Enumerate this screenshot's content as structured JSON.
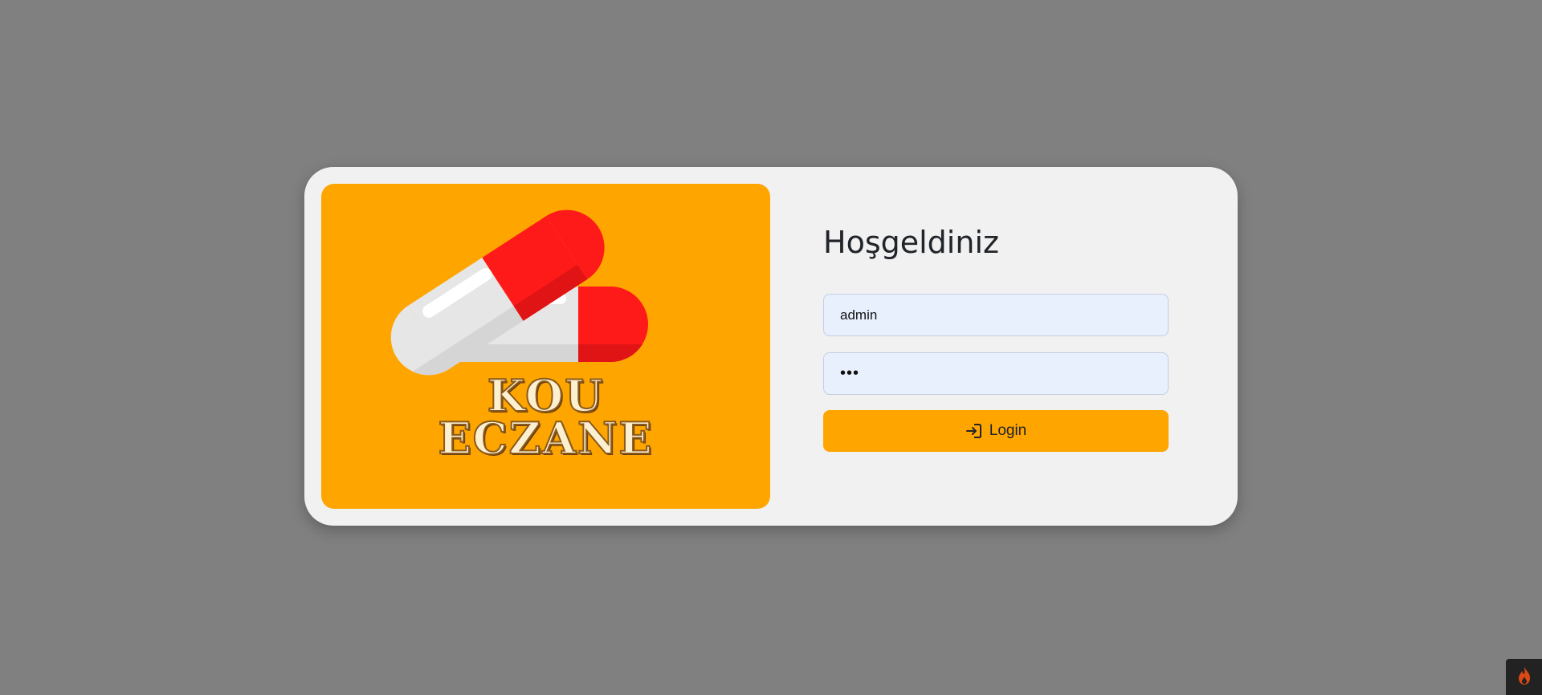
{
  "logo": {
    "line1": "KOU",
    "line2": "ECZANE",
    "background_color": "#ffa500",
    "pill_color": "#ff1a1a",
    "icon": "pill-capsules-icon"
  },
  "login": {
    "title": "Hoşgeldiniz",
    "username_value": "admin",
    "password_value": "•••",
    "button_label": "Login",
    "button_icon": "sign-in-arrow-icon",
    "accent_color": "#ffa500"
  },
  "debug_toolbar": {
    "icon": "flame-icon"
  }
}
